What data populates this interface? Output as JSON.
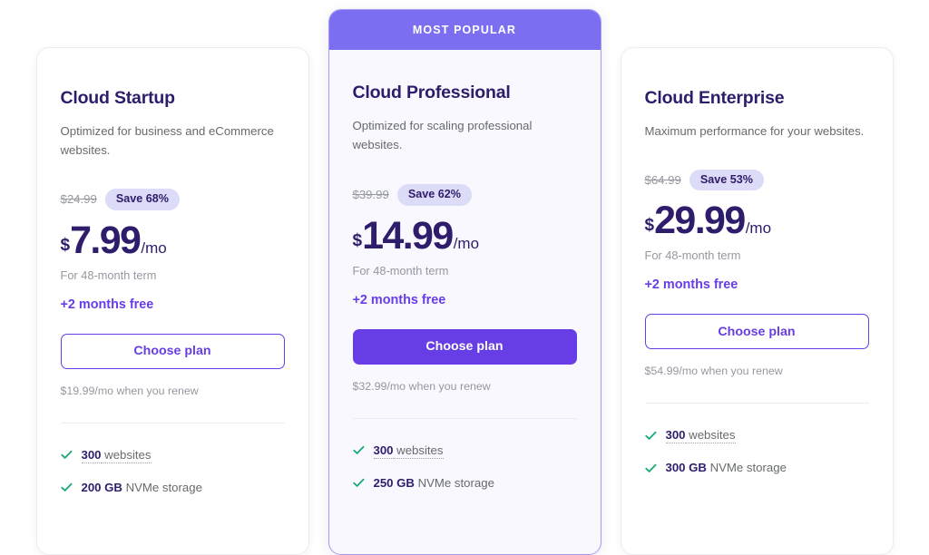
{
  "page": {
    "title": "Hosting plan pricing cards"
  },
  "badge_label": "MOST POPULAR",
  "plans": [
    {
      "id": "cloud-startup",
      "featured": false,
      "name": "Cloud Startup",
      "description": "Optimized for business and eCommerce websites.",
      "old_price": "$24.99",
      "save_badge": "Save 68%",
      "currency": "$",
      "amount": "7.99",
      "per": "/mo",
      "term_note": "For 48-month term",
      "months_free": "+2 months free",
      "cta_label": "Choose plan",
      "renew_note": "$19.99/mo when you renew",
      "features": [
        {
          "strong": "300",
          "rest": " websites",
          "dotted": true
        },
        {
          "strong": "200 GB",
          "rest": " NVMe storage",
          "dotted": false
        }
      ]
    },
    {
      "id": "cloud-professional",
      "featured": true,
      "name": "Cloud Professional",
      "description": "Optimized for scaling professional websites.",
      "old_price": "$39.99",
      "save_badge": "Save 62%",
      "currency": "$",
      "amount": "14.99",
      "per": "/mo",
      "term_note": "For 48-month term",
      "months_free": "+2 months free",
      "cta_label": "Choose plan",
      "renew_note": "$32.99/mo when you renew",
      "features": [
        {
          "strong": "300",
          "rest": " websites",
          "dotted": true
        },
        {
          "strong": "250 GB",
          "rest": " NVMe storage",
          "dotted": false
        }
      ]
    },
    {
      "id": "cloud-enterprise",
      "featured": false,
      "name": "Cloud Enterprise",
      "description": "Maximum performance for your websites.",
      "old_price": "$64.99",
      "save_badge": "Save 53%",
      "currency": "$",
      "amount": "29.99",
      "per": "/mo",
      "term_note": "For 48-month term",
      "months_free": "+2 months free",
      "cta_label": "Choose plan",
      "renew_note": "$54.99/mo when you renew",
      "features": [
        {
          "strong": "300",
          "rest": " websites",
          "dotted": true
        },
        {
          "strong": "300 GB",
          "rest": " NVMe storage",
          "dotted": false
        }
      ]
    }
  ],
  "icons": {
    "check": "check-icon"
  },
  "colors": {
    "accent_purple": "#673de6",
    "banner_purple": "#7b6ef0",
    "heading_navy": "#2f1c6a",
    "badge_bg": "#dcdbf8",
    "muted_text": "#9698a0",
    "body_text": "#676a6c",
    "check_green": "#1ca87c",
    "featured_bg": "#f8f8fe",
    "card_border": "#ebebf2"
  }
}
